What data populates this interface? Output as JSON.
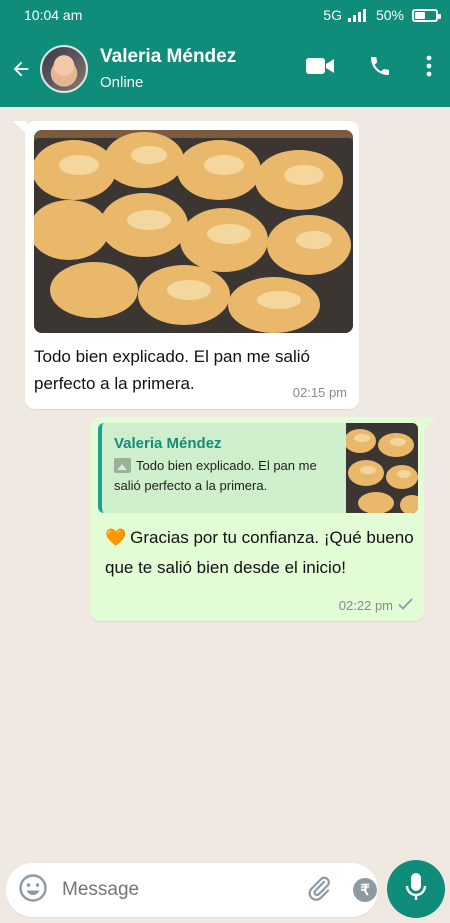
{
  "status_bar": {
    "time": "10:04 am",
    "network": "5G",
    "battery": "50%",
    "battery_level": 0.5
  },
  "header": {
    "contact_name": "Valeria Méndez",
    "presence": "Online",
    "icons": [
      "back-arrow-icon",
      "video-call-icon",
      "phone-icon",
      "more-vert-icon"
    ]
  },
  "messages": [
    {
      "direction": "incoming",
      "has_image": true,
      "text": " Todo bien explicado. El pan me salió perfecto a la primera.",
      "time": "02:15 pm"
    },
    {
      "direction": "outgoing",
      "quote": {
        "author": "Valeria Méndez",
        "text": "Todo bien explicado. El pan me salió perfecto a la primera."
      },
      "emoji": "🧡",
      "text": "Gracias por tu confianza. ¡Qué bueno que te salió bien desde el inicio!",
      "time": "02:22 pm",
      "status": "sent"
    }
  ],
  "composer": {
    "placeholder": "Message",
    "rupee_symbol": "₹",
    "icons": [
      "emoji-icon",
      "attach-icon",
      "payment-icon",
      "camera-icon",
      "mic-icon"
    ]
  },
  "colors": {
    "brand": "#0f8c7a",
    "outgoing_bubble": "#e2fdd6",
    "quote_accent": "#1aa38c",
    "background": "#efe9e2"
  }
}
